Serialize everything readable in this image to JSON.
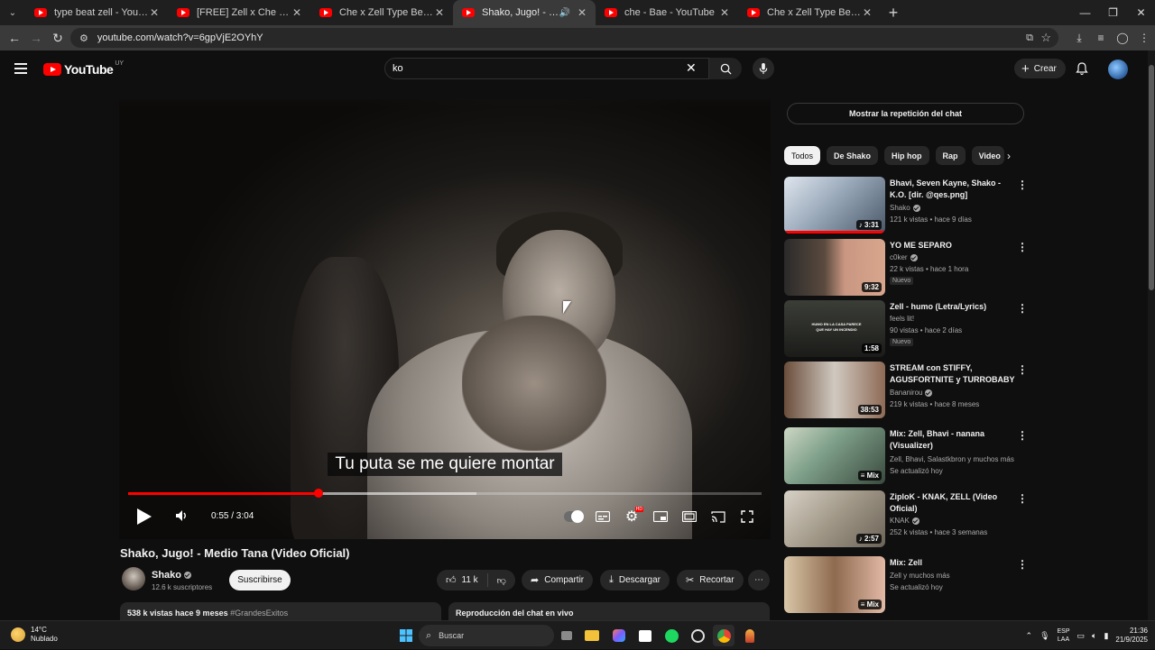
{
  "browser": {
    "tabs": [
      {
        "title": "type beat zell - YouTube"
      },
      {
        "title": "[FREE] Zell x Che x Saramalacara Type Beat"
      },
      {
        "title": "Che x Zell Type Beat \"Distrokid\""
      },
      {
        "title": "Shako, Jugo! - Medio Tana",
        "active": true
      },
      {
        "title": "che - Bae - YouTube"
      },
      {
        "title": "Che x Zell Type Beat \"Primera Vez\""
      }
    ],
    "url": "youtube.com/watch?v=6gpVjE2OYhY"
  },
  "masthead": {
    "logo_text": "YouTube",
    "country_code": "UY",
    "search_value": "ko",
    "create_label": "Crear"
  },
  "player": {
    "caption": "Tu puta se me quiere montar",
    "time": "0:55 / 3:04",
    "progress_fraction": 0.3,
    "buffer_fraction": 0.55,
    "hd_badge": "HD"
  },
  "video": {
    "title": "Shako, Jugo! - Medio Tana (Video Oficial)",
    "channel": "Shako",
    "subscribers": "12.6 k suscriptores",
    "subscribe_label": "Suscribirse",
    "likes": "11 k",
    "share_label": "Compartir",
    "download_label": "Descargar",
    "clip_label": "Recortar",
    "description_stats": "538 k vistas  hace 9 meses",
    "description_tag": "#GrandesExitos",
    "chat_box_label": "Reproducción del chat en vivo"
  },
  "sidebar": {
    "chat_replay_label": "Mostrar la repetición del chat",
    "chips": [
      "Todos",
      "De Shako",
      "Hip hop",
      "Rap",
      "Video"
    ],
    "recommendations": [
      {
        "title": "Bhavi, Seven Kayne, Shako - K.O. [dir. @qes.png]",
        "channel": "Shako",
        "verified": true,
        "meta": "121 k vistas • hace 9 días",
        "duration": "3:31",
        "badge": "",
        "watched": true
      },
      {
        "title": "YO ME SEPARO",
        "channel": "c0ker",
        "verified": true,
        "meta": "22 k vistas • hace 1 hora",
        "duration": "9:32",
        "badge": "Nuevo"
      },
      {
        "title": "Zell - humo (Letra/Lyrics)",
        "channel": "feels lit!",
        "verified": false,
        "meta": "90 vistas • hace 2 días",
        "duration": "1:58",
        "badge": "Nuevo",
        "thumb_text": "HUMO EN LA CASA PARECE QUE HAY UN INCENDIO"
      },
      {
        "title": "STREAM con STIFFY, AGUSFORTNITE y TURROBABY",
        "channel": "Bananirou",
        "verified": true,
        "meta": "219 k vistas • hace 8 meses",
        "duration": "38:53",
        "badge": ""
      },
      {
        "title": "Mix: Zell, Bhavi - nanana (Visualizer)",
        "channel": "Zell, Bhavi, Salastkbron y muchos más",
        "verified": false,
        "meta": "Se actualizó hoy",
        "duration": "Mix",
        "badge": ""
      },
      {
        "title": "ZiploK - KNAK, ZELL (Video Oficial)",
        "channel": "KNAK",
        "verified": true,
        "meta": "252 k vistas • hace 3 semanas",
        "duration": "2:57",
        "badge": ""
      },
      {
        "title": "Mix: Zell",
        "channel": "Zell y muchos más",
        "verified": false,
        "meta": "Se actualizó hoy",
        "duration": "Mix",
        "badge": ""
      }
    ]
  },
  "taskbar": {
    "temperature": "14°C",
    "weather": "Nublado",
    "search_placeholder": "Buscar",
    "lang_1": "ESP",
    "lang_2": "LAA",
    "time": "21:36",
    "date": "21/9/2025"
  },
  "colors": {
    "accent_red": "#ff0000",
    "background": "#0f0f0f",
    "chip_bg": "#272727"
  }
}
